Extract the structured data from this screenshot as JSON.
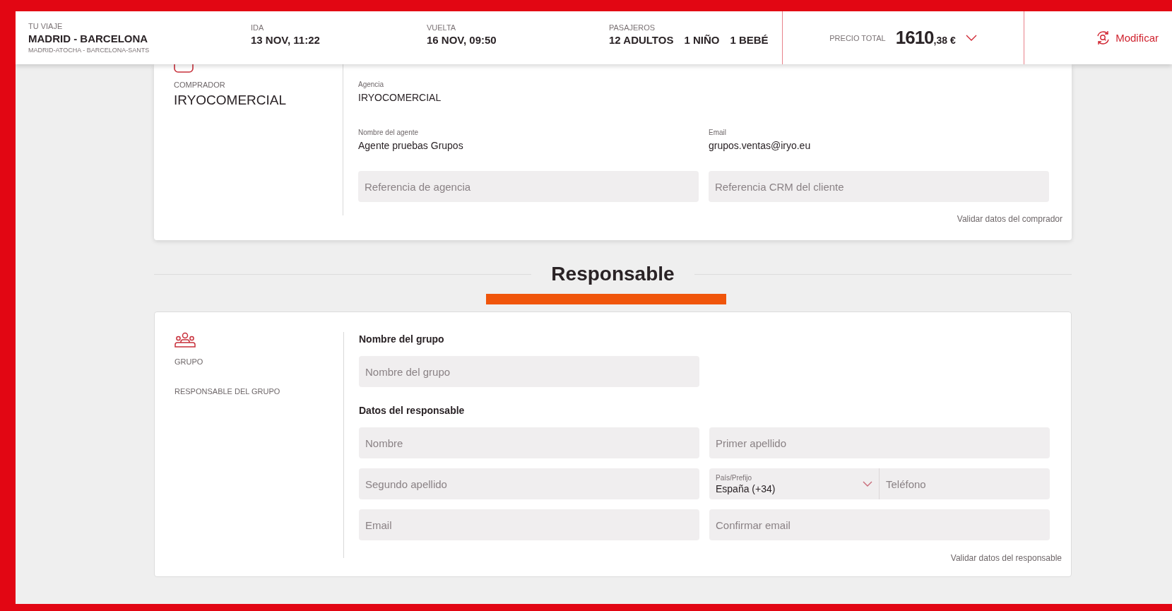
{
  "header": {
    "trip": {
      "label": "TU VIAJE",
      "route": "MADRID - BARCELONA",
      "stations": "MADRID-ATOCHA - BARCELONA-SANTS"
    },
    "outbound": {
      "label": "IDA",
      "value": "13 NOV, 11:22"
    },
    "return": {
      "label": "VUELTA",
      "value": "16 NOV, 09:50"
    },
    "passengers": {
      "label": "PASAJEROS",
      "items": [
        "12 ADULTOS",
        "1 NIÑO",
        "1 BEBÉ"
      ]
    },
    "price": {
      "label": "PRECIO TOTAL",
      "integer": "1610",
      "decimals": ",38 €"
    },
    "modify_button": "Modificar"
  },
  "buyer_card": {
    "section_label": "COMPRADOR",
    "name": "IRYOCOMERCIAL",
    "agency": {
      "label": "Agencia",
      "value": "IRYOCOMERCIAL"
    },
    "details": [
      {
        "label": "Nombre del agente",
        "value": "Agente pruebas Grupos"
      },
      {
        "label": "Email",
        "value": "grupos.ventas@iryo.eu"
      }
    ],
    "inputs": [
      {
        "placeholder": "Referencia de agencia"
      },
      {
        "placeholder": "Referencia CRM del cliente"
      }
    ],
    "validate_link": "Validar datos del comprador"
  },
  "section_title": "Responsable",
  "group_card": {
    "nav": [
      "GRUPO",
      "RESPONSABLE DEL GRUPO"
    ],
    "group_name_heading": "Nombre del grupo",
    "group_name_input": {
      "placeholder": "Nombre del grupo"
    },
    "responsible_heading": "Datos del responsable",
    "input_rows": [
      [
        {
          "kind": "text",
          "placeholder": "Nombre"
        },
        {
          "kind": "text",
          "placeholder": "Primer apellido"
        }
      ],
      [
        {
          "kind": "text",
          "placeholder": "Segundo apellido"
        },
        {
          "kind": "phone",
          "country_label": "País/Prefijo",
          "country_value": "España (+34)",
          "placeholder": "Teléfono"
        }
      ],
      [
        {
          "kind": "text",
          "placeholder": "Email"
        },
        {
          "kind": "text",
          "placeholder": "Confirmar email"
        }
      ]
    ],
    "validate_link": "Validar datos del responsable"
  }
}
